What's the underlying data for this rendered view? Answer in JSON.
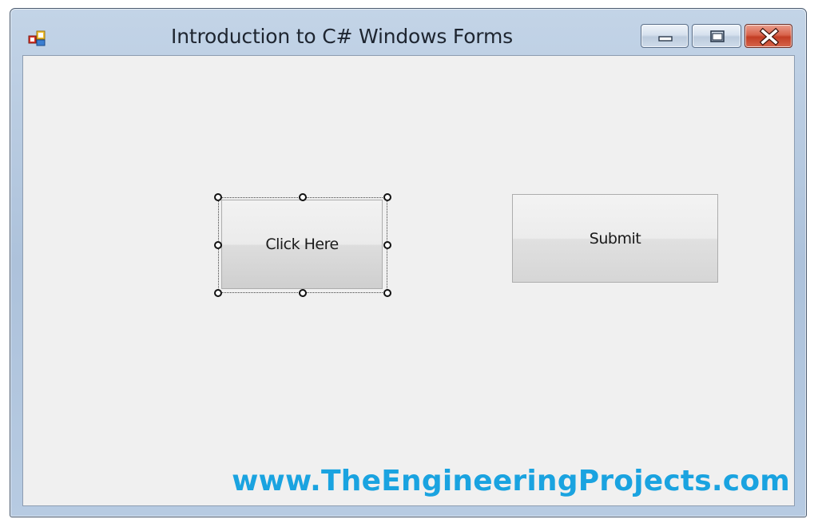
{
  "window": {
    "title": "Introduction to C# Windows Forms",
    "controls": {
      "minimize_icon": "minimize-icon",
      "maximize_icon": "maximize-icon",
      "close_icon": "close-icon"
    },
    "app_icon": "form-icon"
  },
  "form": {
    "buttons": [
      {
        "label": "Click Here",
        "selected": true
      },
      {
        "label": "Submit",
        "selected": false
      }
    ]
  },
  "watermark": {
    "text": "www.TheEngineeringProjects.com",
    "color": "#1aa3e0"
  },
  "colors": {
    "client_background": "#f0f0f0",
    "close_button": "#c94a31",
    "titlebar": "#b9cce3"
  }
}
